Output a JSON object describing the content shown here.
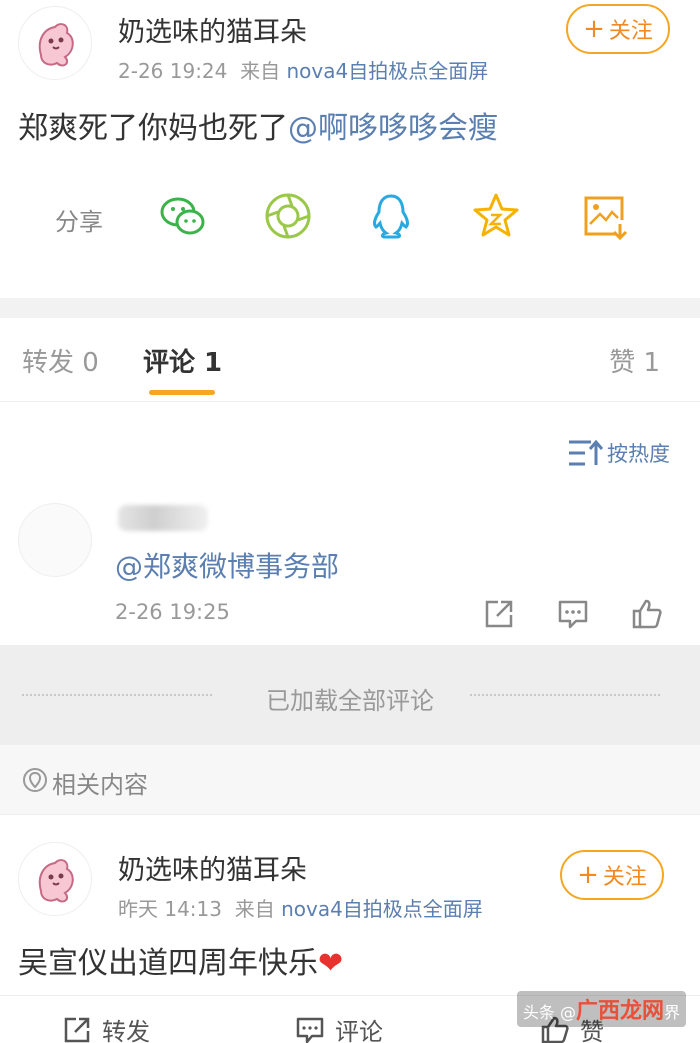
{
  "post1": {
    "username": "奶选味的猫耳朵",
    "time": "2-26 19:24",
    "source_prefix": "来自",
    "source": "nova4自拍极点全面屏",
    "follow_label": "关注",
    "text_plain": "郑爽死了你妈也死了",
    "mention": "@啊哆哆哆会瘦"
  },
  "share": {
    "label": "分享",
    "icons": [
      "wechat-icon",
      "moments-icon",
      "qq-icon",
      "qzone-icon",
      "save-image-icon"
    ]
  },
  "tabs": {
    "repost": "转发 0",
    "comment": "评论 1",
    "like": "赞 1"
  },
  "sort_label": "按热度",
  "comment": {
    "text": "@郑爽微博事务部",
    "time": "2-26 19:25"
  },
  "loaded_all": "已加载全部评论",
  "related_label": "相关内容",
  "post2": {
    "username": "奶选味的猫耳朵",
    "time": "昨天 14:13",
    "source_prefix": "来自",
    "source": "nova4自拍极点全面屏",
    "follow_label": "关注",
    "text": "吴宣仪出道四周年快乐",
    "emoji": "❤"
  },
  "actions": {
    "repost": "转发",
    "comment": "评论",
    "like": "赞"
  },
  "watermark": {
    "prefix": "头条 @",
    "brand": "广西龙网",
    "suffix": "界"
  },
  "colors": {
    "accent": "#f5a623",
    "link": "#5b7fb0",
    "heart": "#e8322f"
  }
}
